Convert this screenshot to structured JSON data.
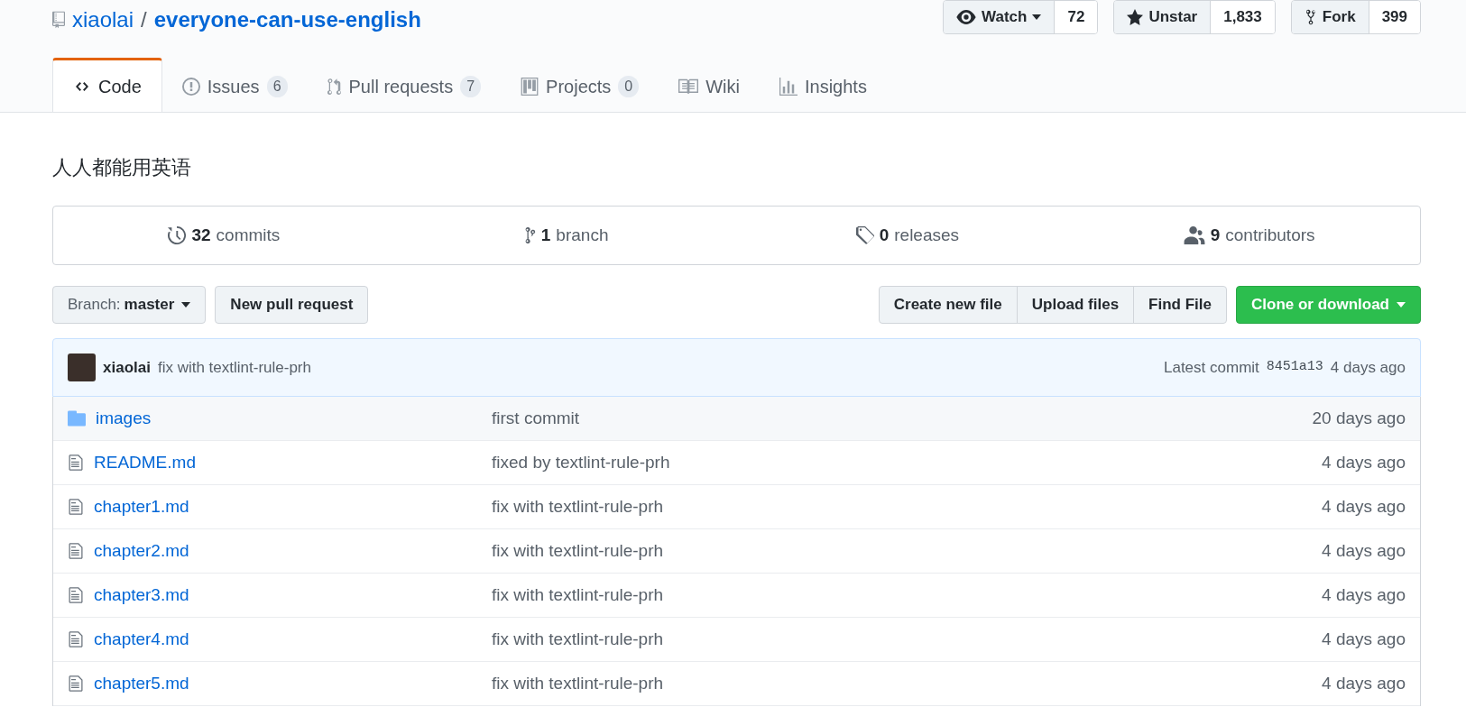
{
  "repo": {
    "owner": "xiaolai",
    "separator": "/",
    "name": "everyone-can-use-english"
  },
  "actions": [
    {
      "kind": "watch",
      "label": "Watch",
      "count": "72"
    },
    {
      "kind": "star",
      "label": "Unstar",
      "count": "1,833"
    },
    {
      "kind": "fork",
      "label": "Fork",
      "count": "399"
    }
  ],
  "tabs": [
    {
      "kind": "code",
      "label": "Code",
      "selected": true
    },
    {
      "kind": "issues",
      "label": "Issues",
      "count": "6",
      "selected": false
    },
    {
      "kind": "pulls",
      "label": "Pull requests",
      "count": "7",
      "selected": false
    },
    {
      "kind": "projects",
      "label": "Projects",
      "count": "0",
      "selected": false
    },
    {
      "kind": "wiki",
      "label": "Wiki",
      "selected": false
    },
    {
      "kind": "insights",
      "label": "Insights",
      "selected": false
    }
  ],
  "description": "人人都能用英语",
  "summary": [
    {
      "kind": "commits",
      "count": "32",
      "label": "commits"
    },
    {
      "kind": "branch",
      "count": "1",
      "label": "branch"
    },
    {
      "kind": "releases",
      "count": "0",
      "label": "releases"
    },
    {
      "kind": "contributors",
      "count": "9",
      "label": "contributors"
    }
  ],
  "branch": {
    "prefix": "Branch:",
    "name": "master"
  },
  "new_pull_request": "New pull request",
  "file_buttons": [
    "Create new file",
    "Upload files",
    "Find File"
  ],
  "clone_button": "Clone or download",
  "latest_commit": {
    "author": "xiaolai",
    "message": "fix with textlint-rule-prh",
    "prefix": "Latest commit",
    "sha": "8451a13",
    "age": "4 days ago"
  },
  "files": [
    {
      "kind": "dir",
      "name": "images",
      "message": "first commit",
      "age": "20 days ago"
    },
    {
      "kind": "file",
      "name": "README.md",
      "message": "fixed by textlint-rule-prh",
      "age": "4 days ago"
    },
    {
      "kind": "file",
      "name": "chapter1.md",
      "message": "fix with textlint-rule-prh",
      "age": "4 days ago"
    },
    {
      "kind": "file",
      "name": "chapter2.md",
      "message": "fix with textlint-rule-prh",
      "age": "4 days ago"
    },
    {
      "kind": "file",
      "name": "chapter3.md",
      "message": "fix with textlint-rule-prh",
      "age": "4 days ago"
    },
    {
      "kind": "file",
      "name": "chapter4.md",
      "message": "fix with textlint-rule-prh",
      "age": "4 days ago"
    },
    {
      "kind": "file",
      "name": "chapter5.md",
      "message": "fix with textlint-rule-prh",
      "age": "4 days ago"
    }
  ]
}
